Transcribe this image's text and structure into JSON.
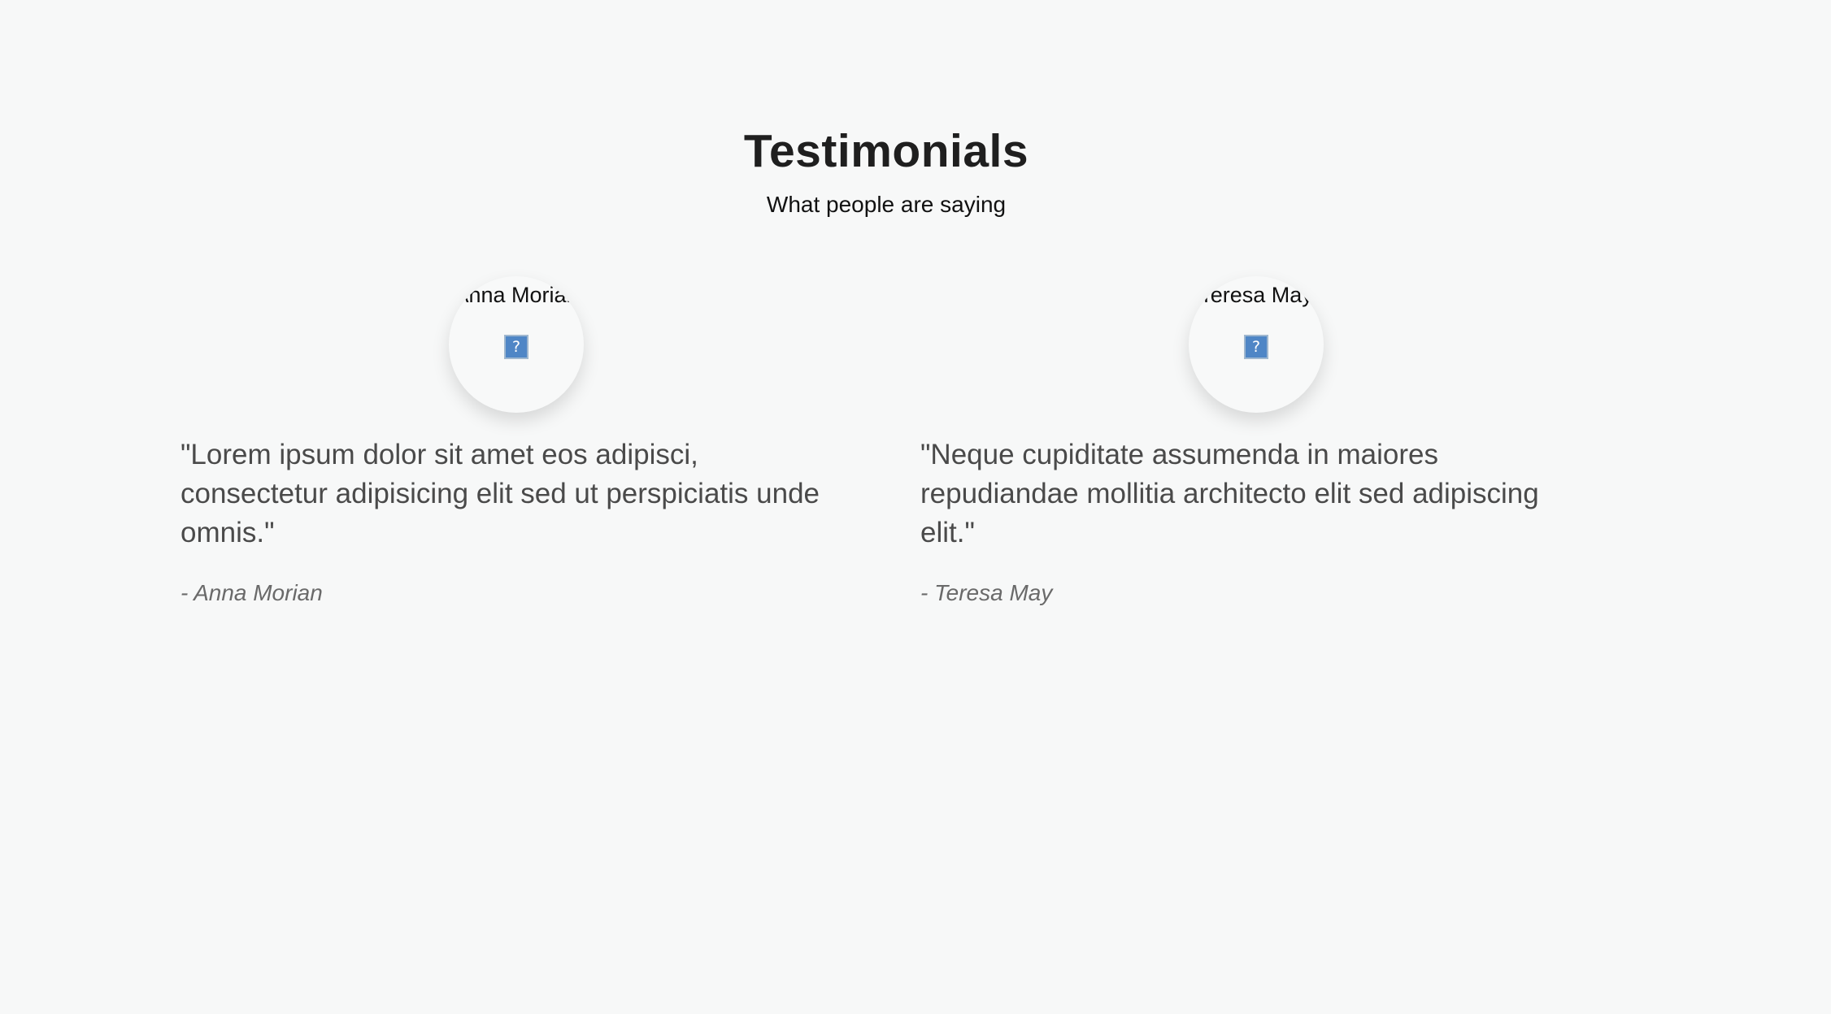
{
  "section": {
    "title": "Testimonials",
    "subtitle": "What people are saying"
  },
  "testimonials": [
    {
      "avatar_alt": "Anna Morian",
      "quote": "\"Lorem ipsum dolor sit amet eos adipisci, consectetur adipisicing elit sed ut perspiciatis unde omnis.\"",
      "author": "- Anna Morian"
    },
    {
      "avatar_alt": "Teresa May",
      "quote": "\"Neque cupiditate assumenda in maiores repudiandae mollitia architecto elit sed adipiscing elit.\"",
      "author": "- Teresa May"
    }
  ],
  "icons": {
    "broken_image": "broken-image-icon"
  }
}
